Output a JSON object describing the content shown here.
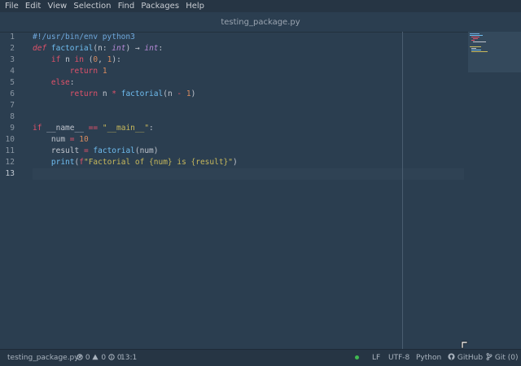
{
  "menu": [
    "File",
    "Edit",
    "View",
    "Selection",
    "Find",
    "Packages",
    "Help"
  ],
  "window_title": "testing_package.py",
  "line_numbers": [
    "1",
    "2",
    "3",
    "4",
    "5",
    "6",
    "7",
    "8",
    "9",
    "10",
    "11",
    "12",
    "13"
  ],
  "code": {
    "l1": "#!/usr/bin/env python3",
    "l2_def": "def ",
    "l2_fn": "factorial",
    "l2_a": "(n: ",
    "l2_t1": "int",
    "l2_b": ") ",
    "l2_arrow": "→",
    "l2_c": " ",
    "l2_t2": "int",
    "l2_d": ":",
    "l3_if": "if",
    "l3_a": " n ",
    "l3_in": "in",
    "l3_b": " (",
    "l3_n0": "0",
    "l3_c": ", ",
    "l3_n1": "1",
    "l3_d": "):",
    "l4_ret": "return",
    "l4_sp": " ",
    "l4_n": "1",
    "l5_else": "else",
    "l5_colon": ":",
    "l6_ret": "return",
    "l6_a": " n ",
    "l6_op": "*",
    "l6_sp": " ",
    "l6_fn": "factorial",
    "l6_b": "(n ",
    "l6_op2": "-",
    "l6_c": " ",
    "l6_n": "1",
    "l6_d": ")",
    "l9_if": "if",
    "l9_a": " __name__ ",
    "l9_op": "==",
    "l9_sp": " ",
    "l9_str": "\"__main__\"",
    "l9_b": ":",
    "l10_a": "num ",
    "l10_op": "=",
    "l10_sp": " ",
    "l10_n": "10",
    "l11_a": "result ",
    "l11_op": "=",
    "l11_sp": " ",
    "l11_fn": "factorial",
    "l11_b": "(num)",
    "l12_fn": "print",
    "l12_a": "(",
    "l12_f": "f",
    "l12_str": "\"Factorial of {num} is {result}\"",
    "l12_b": ")"
  },
  "status": {
    "filename": "testing_package.py*",
    "errors": "0",
    "warnings": "0",
    "infos": "0",
    "position": "13:1",
    "line_ending": "LF",
    "encoding": "UTF-8",
    "grammar": "Python",
    "github": "GitHub",
    "git": "Git (0)"
  },
  "colors": {
    "bg": "#2b3e50",
    "keyword": "#e0526a",
    "function": "#6fbdf0",
    "string": "#c8b95c",
    "number": "#d98c5f",
    "type": "#b88ad8",
    "comment": "#6fa8dc"
  }
}
